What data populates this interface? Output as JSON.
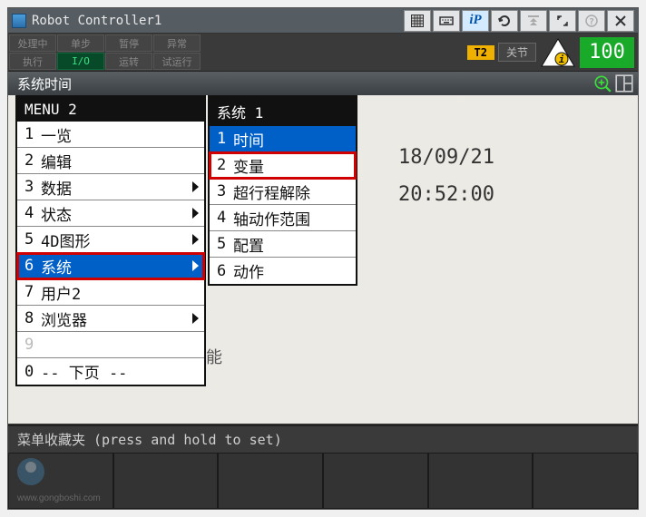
{
  "titlebar": {
    "title": "Robot Controller1",
    "buttons": [
      "grid",
      "keyboard",
      "iP",
      "undo",
      "top",
      "expand",
      "help",
      "close"
    ]
  },
  "status": {
    "cells": [
      "处理中",
      "单步",
      "暂停",
      "异常",
      "执行",
      "I/O",
      "运转",
      "试运行"
    ],
    "green_index": 5,
    "t2": "T2",
    "joint": "关节",
    "speed": "100"
  },
  "header": {
    "title": "系统时间"
  },
  "datetime": {
    "date": "18/09/21",
    "time": "20:52:00"
  },
  "remnant_text": "能",
  "menu1": {
    "title": "MENU  2",
    "items": [
      {
        "n": "1",
        "label": "一览",
        "arrow": false
      },
      {
        "n": "2",
        "label": "编辑",
        "arrow": false
      },
      {
        "n": "3",
        "label": "数据",
        "arrow": true
      },
      {
        "n": "4",
        "label": "状态",
        "arrow": true
      },
      {
        "n": "5",
        "label": "4D图形",
        "arrow": true
      },
      {
        "n": "6",
        "label": "系统",
        "arrow": true,
        "selected": true,
        "redbox": true
      },
      {
        "n": "7",
        "label": "用户2",
        "arrow": false
      },
      {
        "n": "8",
        "label": "浏览器",
        "arrow": true
      },
      {
        "n": "9",
        "label": "",
        "arrow": false,
        "disabled": true
      },
      {
        "n": "0",
        "label": "-- 下页 --",
        "arrow": false
      }
    ]
  },
  "menu2": {
    "title": "系统  1",
    "items": [
      {
        "n": "1",
        "label": "时间",
        "selected": true
      },
      {
        "n": "2",
        "label": "变量",
        "redbox": true
      },
      {
        "n": "3",
        "label": "超行程解除"
      },
      {
        "n": "4",
        "label": "轴动作范围"
      },
      {
        "n": "5",
        "label": "配置"
      },
      {
        "n": "6",
        "label": "动作"
      }
    ]
  },
  "footer": {
    "label": "菜单收藏夹 (press and hold to set)"
  },
  "watermark": "www.gongboshi.com"
}
